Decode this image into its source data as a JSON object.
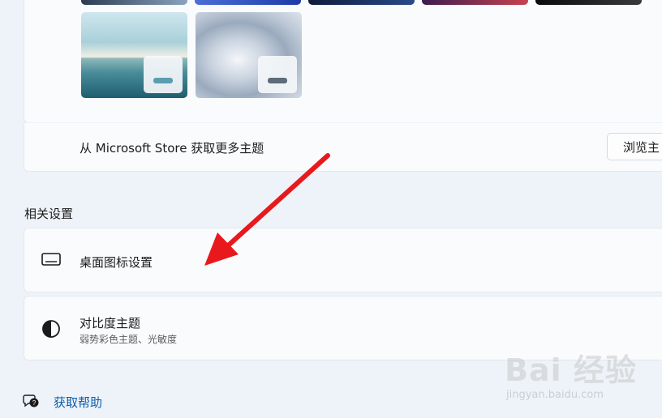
{
  "themes": {
    "store_text": "从 Microsoft Store 获取更多主题",
    "browse_button": "浏览主",
    "thumbnails": [
      {
        "name": "lake",
        "accent": "#5a9db0"
      },
      {
        "name": "flower",
        "accent": "#5d6b7a"
      }
    ]
  },
  "related": {
    "heading": "相关设置",
    "items": [
      {
        "title": "桌面图标设置",
        "subtitle": "",
        "icon": "monitor-icon"
      },
      {
        "title": "对比度主题",
        "subtitle": "弱势彩色主题、光敏度",
        "icon": "contrast-icon"
      }
    ]
  },
  "help": {
    "label": "获取帮助",
    "icon": "help-chat-icon"
  },
  "annotation": {
    "color": "#e8191c"
  },
  "watermark": {
    "text": "Bai 经验",
    "url": "jingyan.baidu.com"
  }
}
